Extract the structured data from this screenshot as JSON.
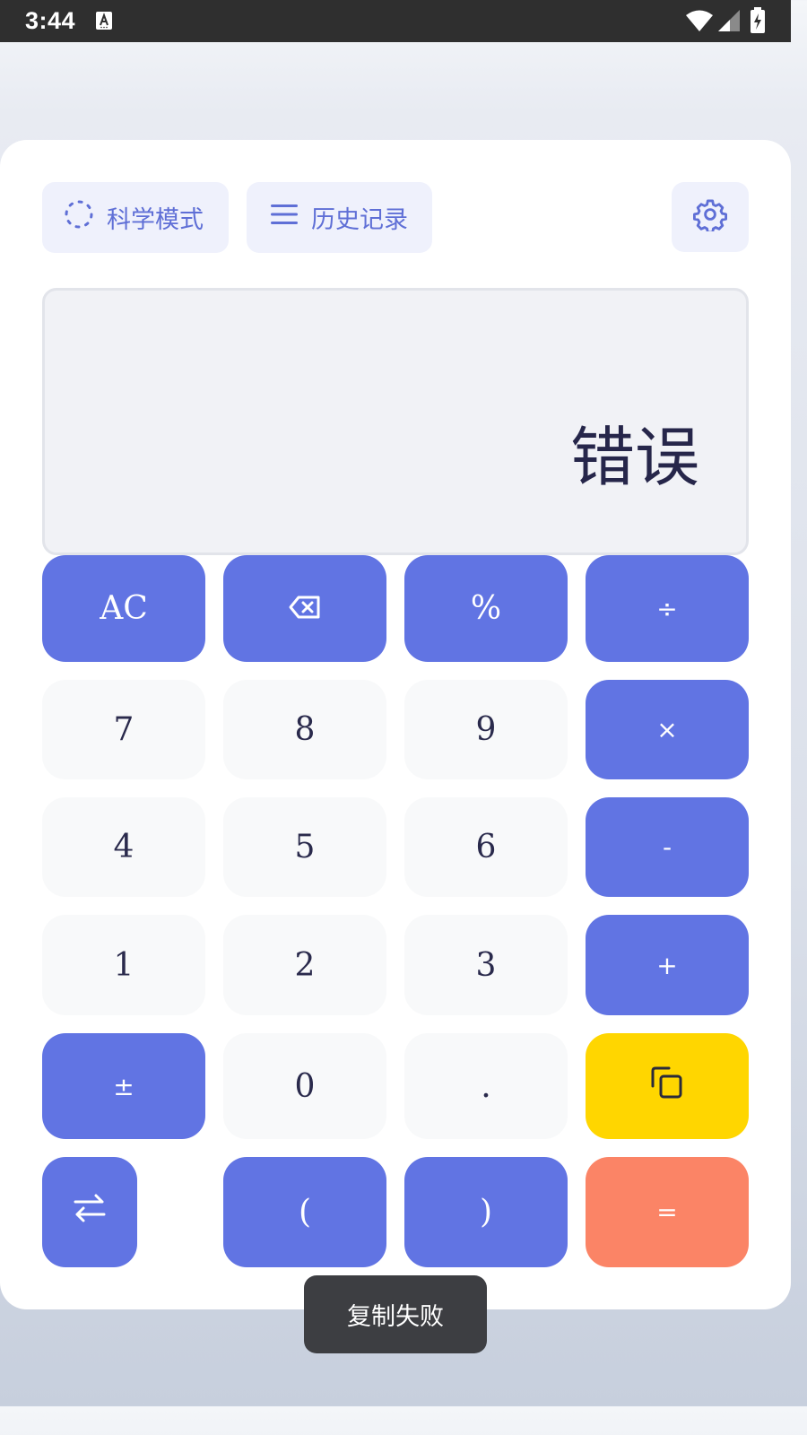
{
  "status_bar": {
    "time": "3:44",
    "icons": [
      "a-notification-icon",
      "wifi-icon",
      "signal-icon",
      "battery-charging-icon"
    ]
  },
  "toolbar": {
    "scientific_mode_label": "科学模式",
    "history_label": "历史记录",
    "icons": [
      "dashed-circle-icon",
      "menu-icon",
      "gear-icon"
    ]
  },
  "display": {
    "value": "错误"
  },
  "keys": {
    "ac": "AC",
    "percent": "%",
    "divide": "÷",
    "seven": "7",
    "eight": "8",
    "nine": "9",
    "multiply": "×",
    "four": "4",
    "five": "5",
    "six": "6",
    "minus": "-",
    "one": "1",
    "two": "2",
    "three": "3",
    "plus": "+",
    "plus_minus": "±",
    "zero": "0",
    "decimal": ".",
    "open_paren": "(",
    "close_paren": ")",
    "equals": "=",
    "icons": [
      "backspace-icon",
      "copy-icon",
      "swap-arrows-icon"
    ]
  },
  "toast": {
    "message": "复制失败"
  },
  "colors": {
    "operator_key": "#6174e3",
    "number_key": "#f8f9fa",
    "copy_key": "#ffd600",
    "equals_key": "#fb8466",
    "accent_text": "#5f6fd6",
    "display_text": "#26264a"
  }
}
